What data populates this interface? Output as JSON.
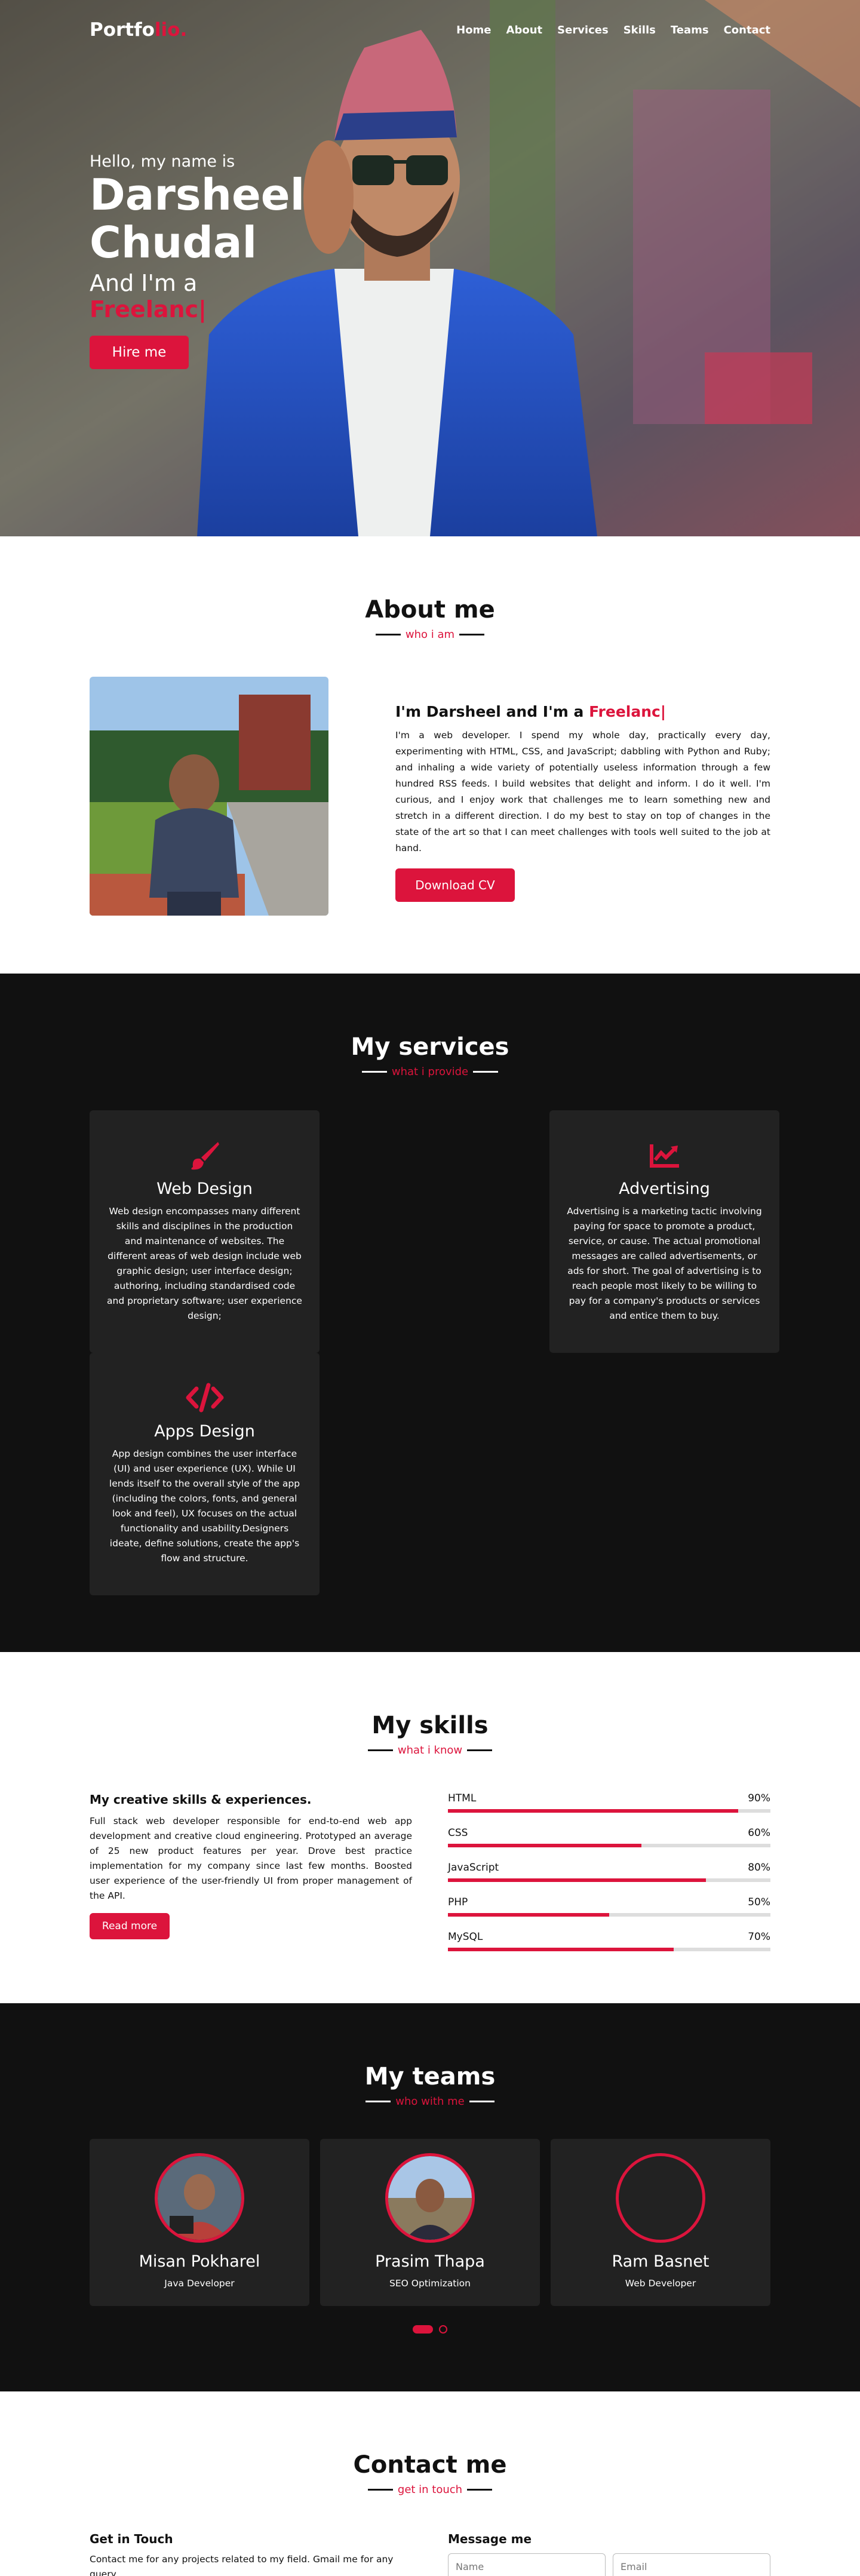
{
  "nav": {
    "logo_main": "Portfo",
    "logo_accent": "lio.",
    "items": [
      {
        "label": "Home"
      },
      {
        "label": "About"
      },
      {
        "label": "Services"
      },
      {
        "label": "Skills"
      },
      {
        "label": "Teams"
      },
      {
        "label": "Contact"
      }
    ]
  },
  "hero": {
    "hello": "Hello, my name is",
    "name": "Darsheel Chudal",
    "and_im": "And I'm a",
    "role": "Freelanc|",
    "hire_label": "Hire me"
  },
  "about": {
    "title": "About me",
    "subtitle": "who i am",
    "heading_main": "I'm Darsheel and I'm a ",
    "heading_accent": "Freelanc|",
    "paragraph": "I'm a web developer. I spend my whole day, practically every day, experimenting with HTML, CSS, and JavaScript; dabbling with Python and Ruby; and inhaling a wide variety of potentially useless information through a few hundred RSS feeds. I build websites that delight and inform. I do it well. I'm curious, and I enjoy work that challenges me to learn something new and stretch in a different direction. I do my best to stay on top of changes in the state of the art so that I can meet challenges with tools well suited to the job at hand.",
    "cv_label": "Download CV"
  },
  "services": {
    "title": "My services",
    "subtitle": "what i provide",
    "cards": [
      {
        "icon": "paint-brush-icon",
        "title": "Web Design",
        "text": "Web design encompasses many different skills and disciplines in the production and maintenance of websites. The different areas of web design include web graphic design; user interface design; authoring, including standardised code and proprietary software; user experience design;"
      },
      {
        "icon": "chart-line-icon",
        "title": "Advertising",
        "text": "Advertising is a marketing tactic involving paying for space to promote a product, service, or cause. The actual promotional messages are called advertisements, or ads for short. The goal of advertising is to reach people most likely to be willing to pay for a company's products or services and entice them to buy."
      },
      {
        "icon": "code-icon",
        "title": "Apps Design",
        "text": "App design combines the user interface (UI) and user experience (UX). While UI lends itself to the overall style of the app (including the colors, fonts, and general look and feel), UX focuses on the actual functionality and usability.Designers ideate, define solutions, create the app's flow and structure."
      }
    ]
  },
  "skills": {
    "title": "My skills",
    "subtitle": "what i know",
    "heading": "My creative skills & experiences.",
    "paragraph": "Full stack web developer responsible for end-to-end web app development and creative cloud engineering. Prototyped an average of 25 new product features per year. Drove best practice implementation for my company since last few months. Boosted user experience of the user-friendly UI from proper management of the API.",
    "more_label": "Read more",
    "bars": [
      {
        "name": "HTML",
        "percent_label": "90%",
        "value": 0.9
      },
      {
        "name": "CSS",
        "percent_label": "60%",
        "value": 0.6
      },
      {
        "name": "JavaScript",
        "percent_label": "80%",
        "value": 0.8
      },
      {
        "name": "PHP",
        "percent_label": "50%",
        "value": 0.5
      },
      {
        "name": "MySQL",
        "percent_label": "70%",
        "value": 0.7
      }
    ]
  },
  "teams": {
    "title": "My teams",
    "subtitle": "who with me",
    "members": [
      {
        "name": "Misan Pokharel",
        "role": "Java Developer"
      },
      {
        "name": "Prasim Thapa",
        "role": "SEO Optimization"
      },
      {
        "name": "Ram Basnet",
        "role": "Web Developer"
      }
    ]
  },
  "contact": {
    "title": "Contact me",
    "subtitle": "get in touch",
    "left_heading": "Get in Touch",
    "left_para": "Contact me for any projects related to my field. Gmail me for any query.",
    "right_heading": "Message me",
    "name_placeholder": "Name",
    "email_placeholder": "Email"
  },
  "colors": {
    "accent": "#dc143c",
    "dark": "#111111",
    "card": "#222222"
  }
}
